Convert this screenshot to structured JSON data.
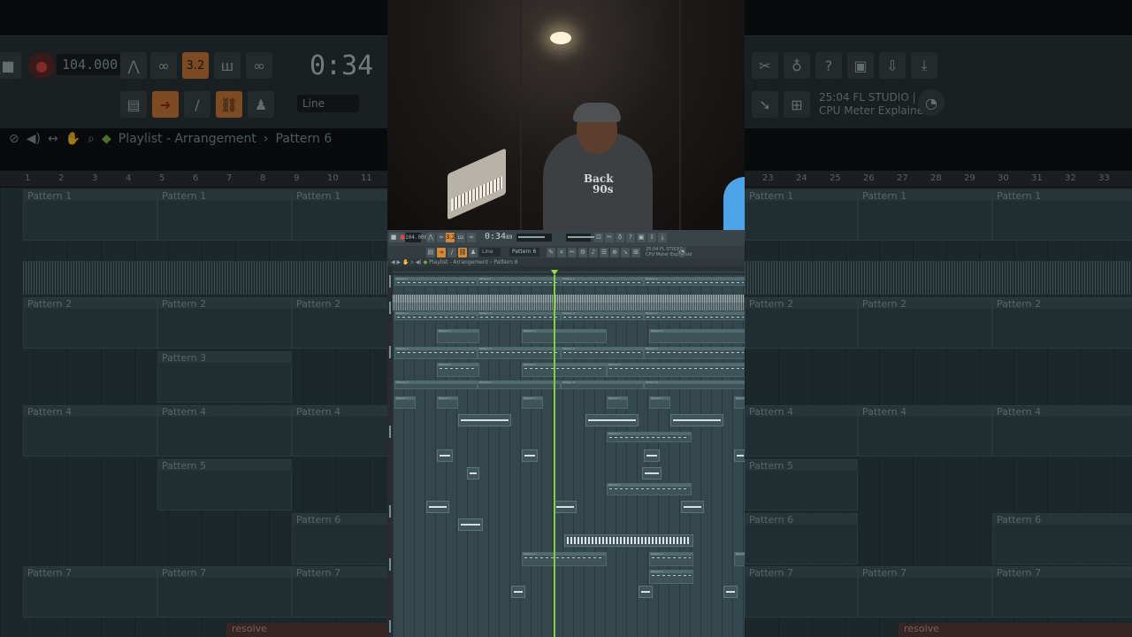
{
  "video": {
    "shirt_text_line1": "Back",
    "shirt_text_line2": "90s"
  },
  "toolbar": {
    "tempo": "104.000",
    "time": "0:34",
    "time_small": "89",
    "snap": "Line",
    "pattern_select": "Pattern 6",
    "news_time": "25:04",
    "news_title": "FL STUDIO |",
    "news_subtitle": "CPU Meter Explained",
    "pattern_digits": "3.2"
  },
  "playlist": {
    "title": "Playlist - Arrangement",
    "separator": "›",
    "current_pattern": "Pattern 6",
    "patterns": [
      "Pattern 1",
      "Pattern 2",
      "Pattern 3",
      "Pattern 4",
      "Pattern 5",
      "Pattern 6",
      "Pattern 7"
    ],
    "bar_numbers_left": [
      "1",
      "2",
      "3",
      "4",
      "5",
      "6",
      "7",
      "8",
      "9",
      "10",
      "11"
    ],
    "bar_numbers_right": [
      "23",
      "24",
      "25",
      "26",
      "27",
      "28",
      "29",
      "30",
      "31",
      "32",
      "33"
    ],
    "resolve_clip": "resolve",
    "audio_clips": [
      "Rolls",
      "Snare",
      "Crash",
      "Stab",
      "Riser"
    ]
  },
  "colors": {
    "accent_orange": "#d08a3e",
    "playhead_green": "#7fd23a",
    "lane_bg": "#33474c",
    "toolbar_bg": "#3a4347"
  }
}
